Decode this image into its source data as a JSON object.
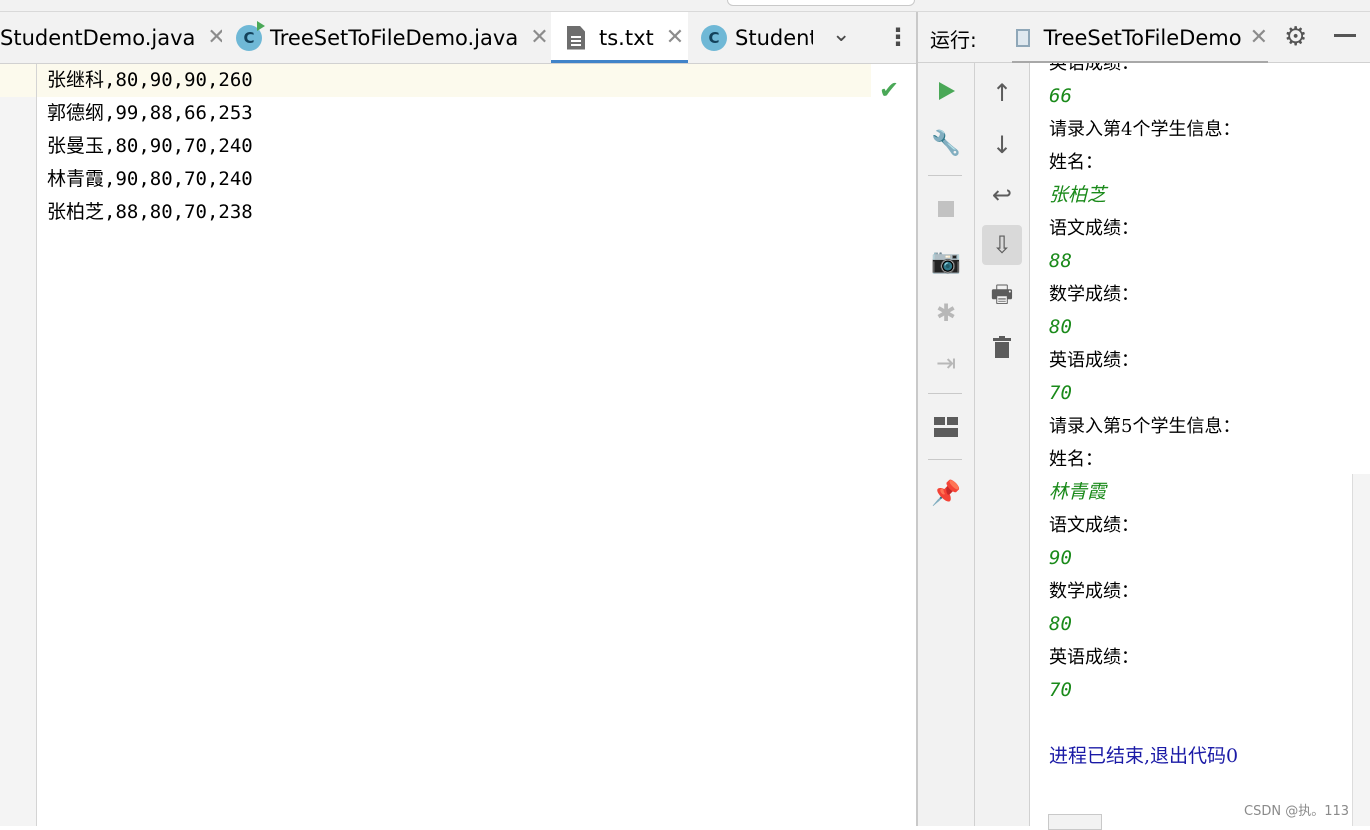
{
  "editor_tabs": [
    {
      "label": "StudentDemo.java",
      "icon": "none"
    },
    {
      "label": "TreeSetToFileDemo.java",
      "icon": "class-run-icon"
    },
    {
      "label": "ts.txt",
      "icon": "text-file-icon"
    },
    {
      "label": "Student",
      "icon": "class-icon"
    }
  ],
  "class_icon_letter": "C",
  "editor": {
    "lines": [
      "张继科,80,90,90,260",
      "郭德纲,99,88,66,253",
      "张曼玉,80,90,70,240",
      "林青霞,90,80,70,240",
      "张柏芝,88,80,70,238"
    ]
  },
  "run_panel": {
    "title": "运行:",
    "tab_label": "TreeSetToFileDemo"
  },
  "console": {
    "lines": [
      {
        "text": "英语成绩：",
        "kind": "label"
      },
      {
        "text": "66",
        "kind": "input"
      },
      {
        "text": "请录入第4个学生信息：",
        "kind": "label"
      },
      {
        "text": "姓名：",
        "kind": "label"
      },
      {
        "text": "张柏芝",
        "kind": "input-cn"
      },
      {
        "text": "语文成绩：",
        "kind": "label"
      },
      {
        "text": "88",
        "kind": "input"
      },
      {
        "text": "数学成绩：",
        "kind": "label"
      },
      {
        "text": "80",
        "kind": "input"
      },
      {
        "text": "英语成绩：",
        "kind": "label"
      },
      {
        "text": "70",
        "kind": "input"
      },
      {
        "text": "请录入第5个学生信息：",
        "kind": "label"
      },
      {
        "text": "姓名：",
        "kind": "label"
      },
      {
        "text": "林青霞",
        "kind": "input-cn"
      },
      {
        "text": "语文成绩：",
        "kind": "label"
      },
      {
        "text": "90",
        "kind": "input"
      },
      {
        "text": "数学成绩：",
        "kind": "label"
      },
      {
        "text": "80",
        "kind": "input"
      },
      {
        "text": "英语成绩：",
        "kind": "label"
      },
      {
        "text": "70",
        "kind": "input"
      },
      {
        "text": "",
        "kind": "blank"
      },
      {
        "text": "进程已结束,退出代码0",
        "kind": "exit"
      }
    ]
  },
  "watermark": "CSDN @执。113",
  "colors": {
    "accent": "#4083c9",
    "input_green": "#1a8a1a",
    "exit_blue": "#1a1aa6",
    "current_line": "#fcfaed"
  }
}
